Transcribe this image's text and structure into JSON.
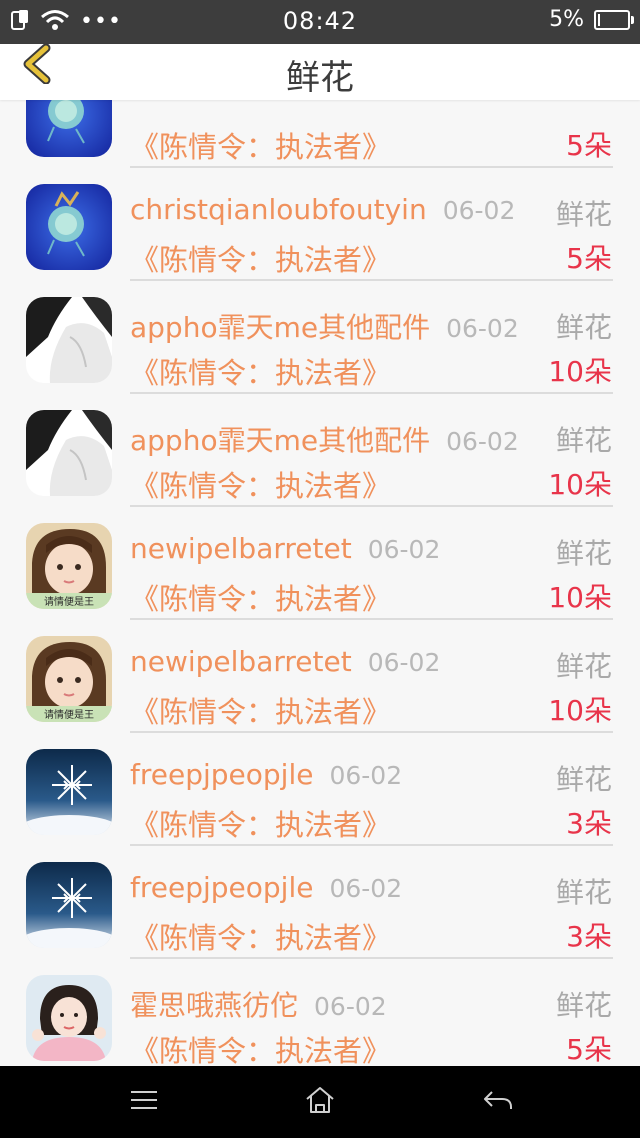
{
  "status_bar": {
    "time": "08:42",
    "battery_text": "5%",
    "battery_level": 0.05,
    "icons": [
      "sim-icon",
      "wifi-icon",
      "more-dots-icon",
      "battery-icon"
    ]
  },
  "header": {
    "title": "鲜花",
    "back_icon": "chevron-left-icon",
    "accent": "#e6c23a"
  },
  "list": {
    "items": [
      {
        "name": "",
        "date": "",
        "type": "",
        "book": "《陈情令：执法者》",
        "count": "5朵",
        "avatar": "blue"
      },
      {
        "name": "christqianloubfoutyin",
        "date": "06-02",
        "type": "鲜花",
        "book": "《陈情令：执法者》",
        "count": "5朵",
        "avatar": "blue"
      },
      {
        "name": "appho霏天me其他配件",
        "date": "06-02",
        "type": "鲜花",
        "book": "《陈情令：执法者》",
        "count": "10朵",
        "avatar": "mono"
      },
      {
        "name": "appho霏天me其他配件",
        "date": "06-02",
        "type": "鲜花",
        "book": "《陈情令：执法者》",
        "count": "10朵",
        "avatar": "mono"
      },
      {
        "name": "newipelbarretet",
        "date": "06-02",
        "type": "鲜花",
        "book": "《陈情令：执法者》",
        "count": "10朵",
        "avatar": "girl"
      },
      {
        "name": "newipelbarretet",
        "date": "06-02",
        "type": "鲜花",
        "book": "《陈情令：执法者》",
        "count": "10朵",
        "avatar": "girl"
      },
      {
        "name": "freepjpeopjle",
        "date": "06-02",
        "type": "鲜花",
        "book": "《陈情令：执法者》",
        "count": "3朵",
        "avatar": "snow"
      },
      {
        "name": "freepjpeopjle",
        "date": "06-02",
        "type": "鲜花",
        "book": "《陈情令：执法者》",
        "count": "3朵",
        "avatar": "snow"
      },
      {
        "name": "霍思哦燕彷佗",
        "date": "06-02",
        "type": "鲜花",
        "book": "《陈情令：执法者》",
        "count": "5朵",
        "avatar": "girl2"
      },
      {
        "name": "霍思哦燕彷佗",
        "date": "06-02",
        "type": "鲜花",
        "book": "",
        "count": "",
        "avatar": "girl2"
      }
    ],
    "avatar_overlay_text": "请情便是王"
  },
  "colors": {
    "name": "#f0915c",
    "date": "#b8b8b8",
    "type": "#a9a9a9",
    "count": "#e8344a",
    "status_bar_bg": "#3d3d3d"
  },
  "nav_bar": {
    "buttons": [
      "menu-icon",
      "home-icon",
      "back-arrow-icon"
    ]
  }
}
